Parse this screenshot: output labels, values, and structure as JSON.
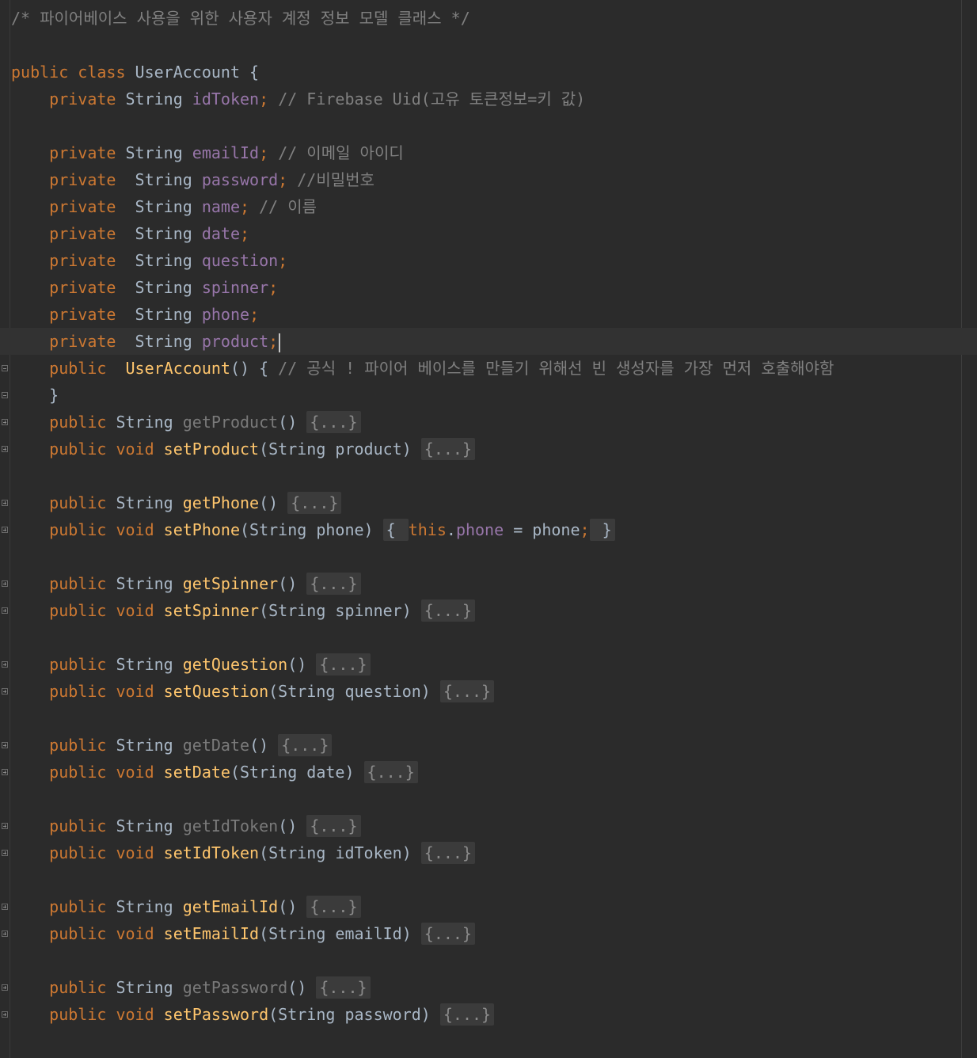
{
  "editor": {
    "lines": [
      {
        "tokens": [
          {
            "c": "comment",
            "t": "/* 파이어베이스 사용을 위한 사용자 계정 정보 모델 클래스 */"
          }
        ]
      },
      {
        "tokens": []
      },
      {
        "tokens": [
          {
            "c": "kw",
            "t": "public class "
          },
          {
            "c": "plain",
            "t": "UserAccount {"
          }
        ]
      },
      {
        "tokens": [
          {
            "c": "plain",
            "t": "    "
          },
          {
            "c": "kw",
            "t": "private "
          },
          {
            "c": "type",
            "t": "String "
          },
          {
            "c": "field",
            "t": "idToken"
          },
          {
            "c": "kw",
            "t": "; "
          },
          {
            "c": "comment",
            "t": "// Firebase Uid(고유 토큰정보=키 값)"
          }
        ]
      },
      {
        "tokens": []
      },
      {
        "tokens": [
          {
            "c": "plain",
            "t": "    "
          },
          {
            "c": "kw",
            "t": "private "
          },
          {
            "c": "type",
            "t": "String "
          },
          {
            "c": "field",
            "t": "emailId"
          },
          {
            "c": "kw",
            "t": "; "
          },
          {
            "c": "comment",
            "t": "// 이메일 아이디"
          }
        ]
      },
      {
        "tokens": [
          {
            "c": "plain",
            "t": "    "
          },
          {
            "c": "kw",
            "t": "private  "
          },
          {
            "c": "type",
            "t": "String "
          },
          {
            "c": "field",
            "t": "password"
          },
          {
            "c": "kw",
            "t": "; "
          },
          {
            "c": "comment",
            "t": "//비밀번호"
          }
        ]
      },
      {
        "tokens": [
          {
            "c": "plain",
            "t": "    "
          },
          {
            "c": "kw",
            "t": "private  "
          },
          {
            "c": "type",
            "t": "String "
          },
          {
            "c": "field",
            "t": "name"
          },
          {
            "c": "kw",
            "t": "; "
          },
          {
            "c": "comment",
            "t": "// 이름"
          }
        ]
      },
      {
        "tokens": [
          {
            "c": "plain",
            "t": "    "
          },
          {
            "c": "kw",
            "t": "private  "
          },
          {
            "c": "type",
            "t": "String "
          },
          {
            "c": "field",
            "t": "date"
          },
          {
            "c": "kw",
            "t": ";"
          }
        ]
      },
      {
        "tokens": [
          {
            "c": "plain",
            "t": "    "
          },
          {
            "c": "kw",
            "t": "private  "
          },
          {
            "c": "type",
            "t": "String "
          },
          {
            "c": "field",
            "t": "question"
          },
          {
            "c": "kw",
            "t": ";"
          }
        ]
      },
      {
        "tokens": [
          {
            "c": "plain",
            "t": "    "
          },
          {
            "c": "kw",
            "t": "private  "
          },
          {
            "c": "type",
            "t": "String "
          },
          {
            "c": "field",
            "t": "spinner"
          },
          {
            "c": "kw",
            "t": ";"
          }
        ]
      },
      {
        "tokens": [
          {
            "c": "plain",
            "t": "    "
          },
          {
            "c": "kw",
            "t": "private  "
          },
          {
            "c": "type",
            "t": "String "
          },
          {
            "c": "field",
            "t": "phone"
          },
          {
            "c": "kw",
            "t": ";"
          }
        ]
      },
      {
        "current": true,
        "caret": true,
        "tokens": [
          {
            "c": "plain",
            "t": "    "
          },
          {
            "c": "kw",
            "t": "private  "
          },
          {
            "c": "type",
            "t": "String "
          },
          {
            "c": "field",
            "t": "product"
          },
          {
            "c": "kw",
            "t": ";"
          }
        ]
      },
      {
        "fold": "minus",
        "tokens": [
          {
            "c": "plain",
            "t": "    "
          },
          {
            "c": "kw",
            "t": "public  "
          },
          {
            "c": "fn",
            "t": "UserAccount"
          },
          {
            "c": "plain",
            "t": "() { "
          },
          {
            "c": "comment",
            "t": "// 공식 ! 파이어 베이스를 만들기 위해선 빈 생성자를 가장 먼저 호출해야함"
          }
        ]
      },
      {
        "fold": "minus",
        "tokens": [
          {
            "c": "plain",
            "t": "    }"
          }
        ]
      },
      {
        "fold": "plus",
        "tokens": [
          {
            "c": "plain",
            "t": "    "
          },
          {
            "c": "kw",
            "t": "public "
          },
          {
            "c": "type",
            "t": "String "
          },
          {
            "c": "dim",
            "t": "getProduct"
          },
          {
            "c": "plain",
            "t": "() "
          },
          {
            "c": "fold",
            "t": "{...}"
          }
        ]
      },
      {
        "fold": "plus",
        "tokens": [
          {
            "c": "plain",
            "t": "    "
          },
          {
            "c": "kw",
            "t": "public void "
          },
          {
            "c": "fn",
            "t": "setProduct"
          },
          {
            "c": "plain",
            "t": "(String product) "
          },
          {
            "c": "fold",
            "t": "{...}"
          }
        ]
      },
      {
        "tokens": []
      },
      {
        "fold": "plus",
        "tokens": [
          {
            "c": "plain",
            "t": "    "
          },
          {
            "c": "kw",
            "t": "public "
          },
          {
            "c": "type",
            "t": "String "
          },
          {
            "c": "fn",
            "t": "getPhone"
          },
          {
            "c": "plain",
            "t": "() "
          },
          {
            "c": "fold",
            "t": "{...}"
          }
        ]
      },
      {
        "fold": "plus",
        "tokens": [
          {
            "c": "plain",
            "t": "    "
          },
          {
            "c": "kw",
            "t": "public void "
          },
          {
            "c": "fn",
            "t": "setPhone"
          },
          {
            "c": "plain",
            "t": "(String phone) "
          },
          {
            "c": "fold inline",
            "t": "{ "
          },
          {
            "c": "kw",
            "t": "this"
          },
          {
            "c": "plain",
            "t": "."
          },
          {
            "c": "field",
            "t": "phone"
          },
          {
            "c": "plain",
            "t": " = phone"
          },
          {
            "c": "kw",
            "t": ";"
          },
          {
            "c": "fold inline",
            "t": " }"
          }
        ]
      },
      {
        "tokens": []
      },
      {
        "fold": "plus",
        "tokens": [
          {
            "c": "plain",
            "t": "    "
          },
          {
            "c": "kw",
            "t": "public "
          },
          {
            "c": "type",
            "t": "String "
          },
          {
            "c": "fn",
            "t": "getSpinner"
          },
          {
            "c": "plain",
            "t": "() "
          },
          {
            "c": "fold",
            "t": "{...}"
          }
        ]
      },
      {
        "fold": "plus",
        "tokens": [
          {
            "c": "plain",
            "t": "    "
          },
          {
            "c": "kw",
            "t": "public void "
          },
          {
            "c": "fn",
            "t": "setSpinner"
          },
          {
            "c": "plain",
            "t": "(String spinner) "
          },
          {
            "c": "fold",
            "t": "{...}"
          }
        ]
      },
      {
        "tokens": []
      },
      {
        "fold": "plus",
        "tokens": [
          {
            "c": "plain",
            "t": "    "
          },
          {
            "c": "kw",
            "t": "public "
          },
          {
            "c": "type",
            "t": "String "
          },
          {
            "c": "fn",
            "t": "getQuestion"
          },
          {
            "c": "plain",
            "t": "() "
          },
          {
            "c": "fold",
            "t": "{...}"
          }
        ]
      },
      {
        "fold": "plus",
        "tokens": [
          {
            "c": "plain",
            "t": "    "
          },
          {
            "c": "kw",
            "t": "public void "
          },
          {
            "c": "fn",
            "t": "setQuestion"
          },
          {
            "c": "plain",
            "t": "(String question) "
          },
          {
            "c": "fold",
            "t": "{...}"
          }
        ]
      },
      {
        "tokens": []
      },
      {
        "fold": "plus",
        "tokens": [
          {
            "c": "plain",
            "t": "    "
          },
          {
            "c": "kw",
            "t": "public "
          },
          {
            "c": "type",
            "t": "String "
          },
          {
            "c": "dim",
            "t": "getDate"
          },
          {
            "c": "plain",
            "t": "() "
          },
          {
            "c": "fold",
            "t": "{...}"
          }
        ]
      },
      {
        "fold": "plus",
        "tokens": [
          {
            "c": "plain",
            "t": "    "
          },
          {
            "c": "kw",
            "t": "public void "
          },
          {
            "c": "fn",
            "t": "setDate"
          },
          {
            "c": "plain",
            "t": "(String date) "
          },
          {
            "c": "fold",
            "t": "{...}"
          }
        ]
      },
      {
        "tokens": []
      },
      {
        "fold": "plus",
        "tokens": [
          {
            "c": "plain",
            "t": "    "
          },
          {
            "c": "kw",
            "t": "public "
          },
          {
            "c": "type",
            "t": "String "
          },
          {
            "c": "dim",
            "t": "getIdToken"
          },
          {
            "c": "plain",
            "t": "() "
          },
          {
            "c": "fold",
            "t": "{...}"
          }
        ]
      },
      {
        "fold": "plus",
        "tokens": [
          {
            "c": "plain",
            "t": "    "
          },
          {
            "c": "kw",
            "t": "public void "
          },
          {
            "c": "fn",
            "t": "setIdToken"
          },
          {
            "c": "plain",
            "t": "(String idToken) "
          },
          {
            "c": "fold",
            "t": "{...}"
          }
        ]
      },
      {
        "tokens": []
      },
      {
        "fold": "plus",
        "tokens": [
          {
            "c": "plain",
            "t": "    "
          },
          {
            "c": "kw",
            "t": "public "
          },
          {
            "c": "type",
            "t": "String "
          },
          {
            "c": "fn",
            "t": "getEmailId"
          },
          {
            "c": "plain",
            "t": "() "
          },
          {
            "c": "fold",
            "t": "{...}"
          }
        ]
      },
      {
        "fold": "plus",
        "tokens": [
          {
            "c": "plain",
            "t": "    "
          },
          {
            "c": "kw",
            "t": "public void "
          },
          {
            "c": "fn",
            "t": "setEmailId"
          },
          {
            "c": "plain",
            "t": "(String emailId) "
          },
          {
            "c": "fold",
            "t": "{...}"
          }
        ]
      },
      {
        "tokens": []
      },
      {
        "fold": "plus",
        "tokens": [
          {
            "c": "plain",
            "t": "    "
          },
          {
            "c": "kw",
            "t": "public "
          },
          {
            "c": "type",
            "t": "String "
          },
          {
            "c": "dim",
            "t": "getPassword"
          },
          {
            "c": "plain",
            "t": "() "
          },
          {
            "c": "fold",
            "t": "{...}"
          }
        ]
      },
      {
        "fold": "plus",
        "tokens": [
          {
            "c": "plain",
            "t": "    "
          },
          {
            "c": "kw",
            "t": "public void "
          },
          {
            "c": "fn",
            "t": "setPassword"
          },
          {
            "c": "plain",
            "t": "(String password) "
          },
          {
            "c": "fold",
            "t": "{...}"
          }
        ]
      }
    ]
  }
}
